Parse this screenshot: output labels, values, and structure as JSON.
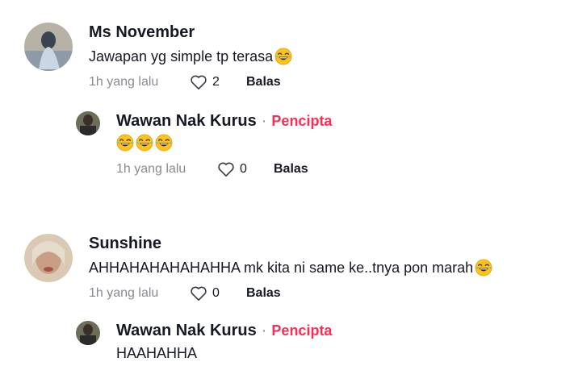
{
  "comments": [
    {
      "author": "Ms November",
      "text": "Jawapan yg simple tp terasa",
      "emoji": "tears-of-joy",
      "time": "1h yang lalu",
      "likes": "2",
      "reply_label": "Balas",
      "reply": {
        "author": "Wawan Nak Kurus",
        "separator": "·",
        "badge": "Pencipta",
        "emoji_count": 3,
        "time": "1h yang lalu",
        "likes": "0",
        "reply_label": "Balas"
      }
    },
    {
      "author": "Sunshine",
      "text": "AHHAHAHAHAHAHHA mk kita ni same ke..tnya pon marah",
      "emoji": "tears-of-joy",
      "time": "1h yang lalu",
      "likes": "0",
      "reply_label": "Balas",
      "reply": {
        "author": "Wawan Nak Kurus",
        "separator": "·",
        "badge": "Pencipta",
        "text": "HAAHAHHA"
      }
    }
  ],
  "colors": {
    "creator": "#fe2c55",
    "muted": "#8a8b91",
    "text": "#161823"
  }
}
